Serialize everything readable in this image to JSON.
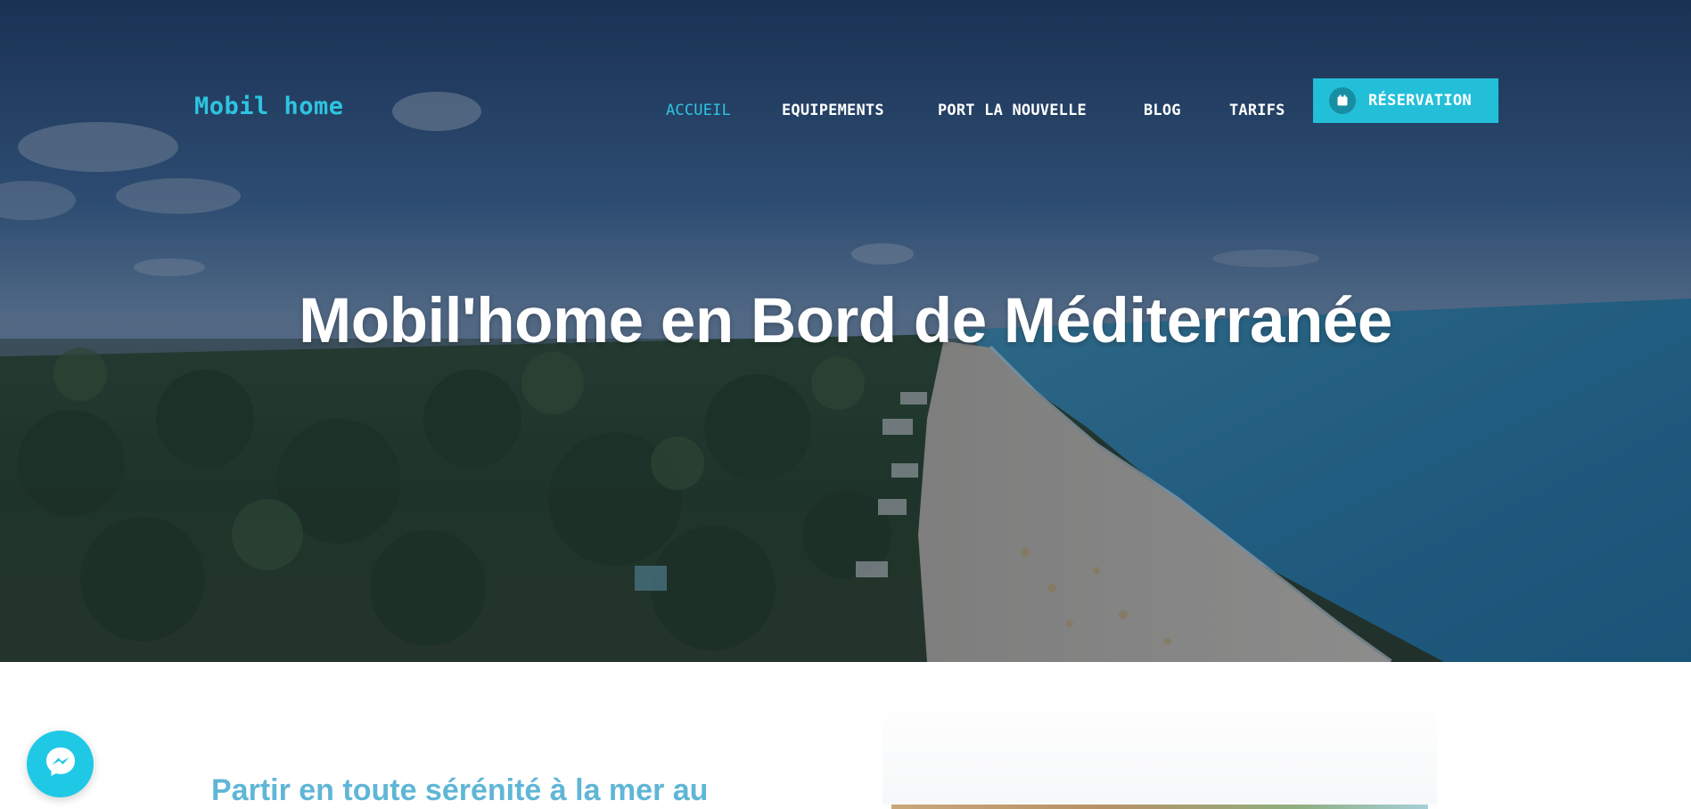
{
  "header": {
    "logo": "Mobil home",
    "nav": [
      {
        "label": "ACCUEIL",
        "active": true
      },
      {
        "label": "EQUIPEMENTS",
        "active": false
      },
      {
        "label": "PORT LA NOUVELLE",
        "active": false
      },
      {
        "label": "BLOG",
        "active": false
      },
      {
        "label": "TARIFS",
        "active": false
      }
    ],
    "reservation_label": "RÉSERVATION",
    "reservation_icon": "calendar-icon"
  },
  "hero": {
    "title": "Mobil'home en Bord de Méditerranée"
  },
  "intro": {
    "heading": "Partir en toute sérénité à la mer au"
  },
  "chat": {
    "icon": "messenger-icon"
  },
  "colors": {
    "accent": "#2ec4e0",
    "button": "#23bfd9",
    "heading": "#5fb6d6"
  }
}
